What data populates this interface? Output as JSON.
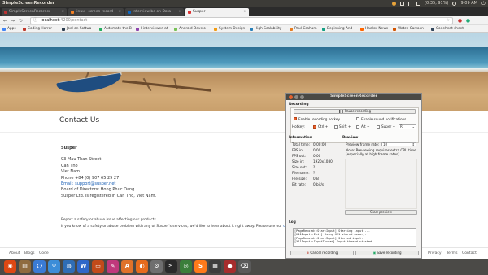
{
  "topbar": {
    "title": "SimpleScreenRecorder",
    "battery": "(0:35, 91%)",
    "clock": "9:09 AM"
  },
  "tabs": [
    {
      "label": "SimpleScreenRecorder",
      "active": false
    },
    {
      "label": "linux - screen record",
      "active": false
    },
    {
      "label": "Interview be on Data",
      "active": false
    },
    {
      "label": "Susper",
      "active": true
    }
  ],
  "omnibox": {
    "host": "localhost",
    "path": ":4200/contact"
  },
  "bookmarks": [
    {
      "label": "Apps",
      "color": "#4285f4"
    },
    {
      "label": "Coding Horror",
      "color": "#c0392b"
    },
    {
      "label": "Joel on Softwa",
      "color": "#2c3e50"
    },
    {
      "label": "Automate the B",
      "color": "#27ae60"
    },
    {
      "label": "I interviewed at",
      "color": "#8e44ad"
    },
    {
      "label": "Android Develo",
      "color": "#78c257"
    },
    {
      "label": "System Design",
      "color": "#f39c12"
    },
    {
      "label": "High Scalability",
      "color": "#2980b9"
    },
    {
      "label": "Paul Graham",
      "color": "#e67e22"
    },
    {
      "label": "Beginning And",
      "color": "#16a085"
    },
    {
      "label": "Hacker News",
      "color": "#ff6600"
    },
    {
      "label": "Watch Cartoon",
      "color": "#d35400"
    },
    {
      "label": "Codeheat sheet",
      "color": "#34495e"
    }
  ],
  "page": {
    "contact_title": "Contact Us",
    "company": "Susper",
    "address": [
      "93 Mau Than Street",
      "Can Tho",
      "Viet Nam",
      "Phone +84 (0) 907 65 29 27"
    ],
    "email": "Email: support@susper.net",
    "board": "Board of Directors: Hong Phuc Dang",
    "registered": "Susper Ltd. is registered in Can Tho, Viet Nam.",
    "report_title": "Report a safety or abuse issue affecting our products.",
    "report_text": "If you know of a safety or abuse problem with any of Susper's services, we'd like to hear about it right away. Please use our",
    "report_link": "contact f",
    "footer_left": [
      "About",
      "Blogs",
      "Code"
    ],
    "footer_right": [
      "Privacy",
      "Terms",
      "Contact"
    ]
  },
  "ssr": {
    "title": "SimpleScreenRecorder",
    "recording_label": "Recording",
    "pause_button": "Pause recording",
    "enable_hotkey": "Enable recording hotkey",
    "enable_sound": "Enable sound notifications",
    "hotkey_label": "Hotkey:",
    "ctrl": "Ctrl +",
    "shift": "Shift +",
    "alt": "Alt +",
    "super": "Super +",
    "key": "R",
    "info_label": "Information",
    "info": [
      {
        "k": "Total time:",
        "v": "0:00:00"
      },
      {
        "k": "FPS in:",
        "v": "0.00"
      },
      {
        "k": "FPS out:",
        "v": "0.00"
      },
      {
        "k": "Size in:",
        "v": "1920x1080"
      },
      {
        "k": "Size out:",
        "v": "?"
      },
      {
        "k": "File name:",
        "v": "?"
      },
      {
        "k": "File size:",
        "v": "0 B"
      },
      {
        "k": "Bit rate:",
        "v": "0 bit/s"
      }
    ],
    "preview_label": "Preview",
    "preview_frame_rate_label": "Preview frame rate:",
    "preview_frame_rate": "10",
    "preview_note": "Note: Previewing requires extra CPU time (especially at high frame rates).",
    "start_preview": "Start preview",
    "log_label": "Log",
    "log": [
      "[PageRecord::StartInput] Starting input ...",
      "[X11Input::Init] Using X11 shared memory.",
      "[PageRecord::StartInput] Started input.",
      "[X11Input::InputThread] Input thread started."
    ],
    "cancel_button": "Cancel recording",
    "save_button": "Save recording"
  },
  "dock": [
    {
      "name": "ubuntu-icon",
      "color": "#dd4814",
      "glyph": "◉"
    },
    {
      "name": "files-icon",
      "color": "#8f6b3f",
      "glyph": "▤"
    },
    {
      "name": "vscode-icon",
      "color": "#3a7bd5",
      "glyph": "❮❯"
    },
    {
      "name": "kde-connect-icon",
      "color": "#3c8dd8",
      "glyph": "⚲"
    },
    {
      "name": "chromium-icon",
      "color": "#2f6db5",
      "glyph": "◍"
    },
    {
      "name": "writer-icon",
      "color": "#2f67c9",
      "glyph": "W"
    },
    {
      "name": "impress-icon",
      "color": "#c24a1a",
      "glyph": "▭"
    },
    {
      "name": "pinta-icon",
      "color": "#c0387c",
      "glyph": "✎"
    },
    {
      "name": "software-icon",
      "color": "#e0722a",
      "glyph": "A"
    },
    {
      "name": "firefox-icon",
      "color": "#e76b1c",
      "glyph": "◐"
    },
    {
      "name": "settings-icon",
      "color": "#6f6f6f",
      "glyph": "⚙"
    },
    {
      "name": "terminal-icon",
      "color": "#2a2a2a",
      "glyph": ">_"
    },
    {
      "name": "chrome-icon",
      "color": "#3b7e3b",
      "glyph": "◎"
    },
    {
      "name": "sublime-icon",
      "color": "#ff7a1a",
      "glyph": "S"
    },
    {
      "name": "calc-icon",
      "color": "#3d3d3d",
      "glyph": "▦"
    },
    {
      "name": "recorder-icon",
      "color": "#a62d2d",
      "glyph": "●"
    },
    {
      "name": "trash-icon",
      "color": "#5a5a5a",
      "glyph": "🗑"
    }
  ]
}
